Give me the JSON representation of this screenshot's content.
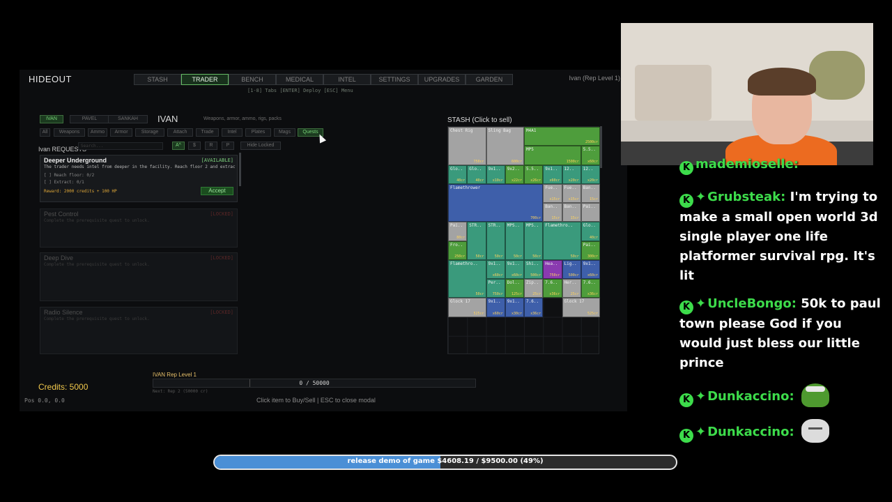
{
  "game": {
    "title": "HIDEOUT",
    "tabs": [
      {
        "label": "STASH"
      },
      {
        "label": "TRADER"
      },
      {
        "label": "BENCH"
      },
      {
        "label": "MEDICAL"
      },
      {
        "label": "INTEL"
      },
      {
        "label": "SETTINGS"
      },
      {
        "label": "UPGRADES"
      },
      {
        "label": "GARDEN"
      }
    ],
    "active_tab": "TRADER",
    "nav_hint": "[1-8] Tabs  [ENTER] Deploy  [ESC] Menu",
    "rep_top": "Ivan (Rep Level 1)",
    "traders": [
      "IVAN",
      "PAVEL",
      "SANKAH"
    ],
    "trader_name": "IVAN",
    "trader_desc": "Weapons, armor, ammo, rigs, packs",
    "filters": [
      "All",
      "Weapons",
      "Ammo",
      "Armor",
      "Storage",
      "Attach",
      "Trade",
      "Intel",
      "Plates",
      "Mags",
      "Quests"
    ],
    "active_filter": "Quests",
    "requests_title": "Ivan REQUESTS",
    "search_placeholder": "Search...",
    "sort_buttons": [
      "A^",
      "$",
      "R",
      "P"
    ],
    "hide_locked": "Hide Locked",
    "quests": [
      {
        "title": "Deeper Underground",
        "status": "[AVAILABLE]",
        "desc": "The trader needs intel from deeper in the facility. Reach floor 2 and extract a",
        "objectives": [
          "[ ]  Reach floor: 0/2",
          "[ ]  Extract: 0/1"
        ],
        "reward": "Reward: 2000 credits + 100 HP",
        "accept": "Accept"
      },
      {
        "title": "Pest Control",
        "status": "[LOCKED]",
        "desc": "Complete the prerequisite quest to unlock."
      },
      {
        "title": "Deep Dive",
        "status": "[LOCKED]",
        "desc": "Complete the prerequisite quest to unlock."
      },
      {
        "title": "Radio Silence",
        "status": "[LOCKED]",
        "desc": "Complete the prerequisite quest to unlock."
      }
    ],
    "stash_title": "STASH (Click to sell)",
    "stash_items": [
      {
        "label": "Chest Rig",
        "price": "750cr",
        "color": "#a3a3a3"
      },
      {
        "label": "Sling Bag",
        "price": "600cr",
        "color": "#a3a3a3"
      },
      {
        "label": "M4A1",
        "price": "2500cr",
        "color": "#4e9d3c"
      },
      {
        "label": "MP5",
        "price": "1500cr",
        "color": "#4e9d3c"
      },
      {
        "label": "5.5..",
        "price": "x60cr",
        "color": "#4e9d3c"
      },
      {
        "label": "Glo..",
        "price": "40cr",
        "color": "#3a9a7c"
      },
      {
        "label": "Glo..",
        "price": "40cr",
        "color": "#3a9a7c"
      },
      {
        "label": "9x1..",
        "price": "x10cr",
        "color": "#3a9a7c"
      },
      {
        "label": "9x2..",
        "price": "x22cr",
        "color": "#4e9d3c"
      },
      {
        "label": "5.5..",
        "price": "x26cr",
        "color": "#4e9d3c"
      },
      {
        "label": "9x1..",
        "price": "x60cr",
        "color": "#3a9a7c"
      },
      {
        "label": "12..",
        "price": "x20cr",
        "color": "#3a9a7c"
      },
      {
        "label": "12..",
        "price": "x20cr",
        "color": "#3a9a7c"
      },
      {
        "label": "Flamethrower",
        "price": "700cr",
        "color": "#3e5faa"
      },
      {
        "label": "Fue..",
        "price": "x15cr",
        "color": "#a3a3a3"
      },
      {
        "label": "Fue..",
        "price": "x15cr",
        "color": "#a3a3a3"
      },
      {
        "label": "Ban..",
        "price": "15cr",
        "color": "#a3a3a3"
      },
      {
        "label": "Ban..",
        "price": "15cr",
        "color": "#a3a3a3"
      },
      {
        "label": "Ban..",
        "price": "15cr",
        "color": "#a3a3a3"
      },
      {
        "label": "Pai..",
        "price": "",
        "color": "#a3a3a3"
      },
      {
        "label": "Pai..",
        "price": "80cr",
        "color": "#a3a3a3"
      },
      {
        "label": "STR..",
        "price": "50cr",
        "color": "#3a9a7c"
      },
      {
        "label": "STR..",
        "price": "50cr",
        "color": "#3a9a7c"
      },
      {
        "label": "MPS..",
        "price": "50cr",
        "color": "#3a9a7c"
      },
      {
        "label": "MPS..",
        "price": "50cr",
        "color": "#3a9a7c"
      },
      {
        "label": "Flamethro..",
        "price": "50cr",
        "color": "#3a9a7c"
      },
      {
        "label": "Glo..",
        "price": "40cr",
        "color": "#3a9a7c"
      },
      {
        "label": "Pai..",
        "price": "300cr",
        "color": "#4e9d3c"
      },
      {
        "label": "Fro..",
        "price": "250cr",
        "color": "#4e9d3c"
      },
      {
        "label": "Flamethro..",
        "price": "50cr",
        "color": "#3a9a7c"
      },
      {
        "label": "9x1..",
        "price": "x60cr",
        "color": "#3a9a7c"
      },
      {
        "label": "9x1..",
        "price": "x60cr",
        "color": "#3a9a7c"
      },
      {
        "label": "Shi..",
        "price": "500cr",
        "color": "#3a9a7c"
      },
      {
        "label": "Hea..",
        "price": "750cr",
        "color": "#8a3ab0"
      },
      {
        "label": "Lig..",
        "price": "500cr",
        "color": "#3e5faa"
      },
      {
        "label": "9x1..",
        "price": "x60cr",
        "color": "#3e5faa"
      },
      {
        "label": "Per..",
        "price": "750cr",
        "color": "#3a9a7c"
      },
      {
        "label": "Dol..",
        "price": "125cr",
        "color": "#4e9d3c"
      },
      {
        "label": "Zip..",
        "price": "25cr",
        "color": "#a3a3a3"
      },
      {
        "label": "7.6..",
        "price": "x36cr",
        "color": "#4e9d3c"
      },
      {
        "label": "Her..",
        "price": "25cr",
        "color": "#a3a3a3"
      },
      {
        "label": "7.6..",
        "price": "x36cr",
        "color": "#4e9d3c"
      },
      {
        "label": "Glock 17",
        "price": "525cr",
        "color": "#a3a3a3"
      },
      {
        "label": "9x1..",
        "price": "x60cr",
        "color": "#3e5faa"
      },
      {
        "label": "9x1..",
        "price": "x30cr",
        "color": "#3e5faa"
      },
      {
        "label": "7.6..",
        "price": "x36cr",
        "color": "#3e5faa"
      },
      {
        "label": "Glock 17",
        "price": "525cr",
        "color": "#a3a3a3"
      }
    ],
    "credits": "Credits: 5000",
    "pos": "Pos 0.0, 0.0",
    "rep_level": "IVAN Rep Level 1",
    "rep_progress_text": "0 / 50000",
    "rep_progress": 0.0,
    "rep_next": "Next: Rep 2 (50000 cr)",
    "footer_hint": "Click item to Buy/Sell  |  ESC to close modal"
  },
  "chat": [
    {
      "user": "mademioselle:",
      "text": "",
      "badges": [
        "K"
      ],
      "sub": false
    },
    {
      "user": "Grubsteak:",
      "text": "I'm trying to make a small open world 3d single player one life platformer survival rpg. It's lit",
      "badges": [
        "K"
      ],
      "sub": true
    },
    {
      "user": "UncleBongo:",
      "text": "50k to paul town please God if you would just bless our little prince",
      "badges": [
        "K"
      ],
      "sub": true
    },
    {
      "user": "Dunkaccino:",
      "text": "",
      "badges": [
        "K"
      ],
      "sub": true,
      "emote": "pepe-emote"
    },
    {
      "user": "Dunkaccino:",
      "text": "",
      "badges": [
        "K"
      ],
      "sub": true,
      "emote": "cat-emote"
    }
  ],
  "goal": {
    "text": "release demo of game $4608.19 / $9500.00 (49%)",
    "progress": 0.49,
    "color": "#4a8fd6"
  }
}
